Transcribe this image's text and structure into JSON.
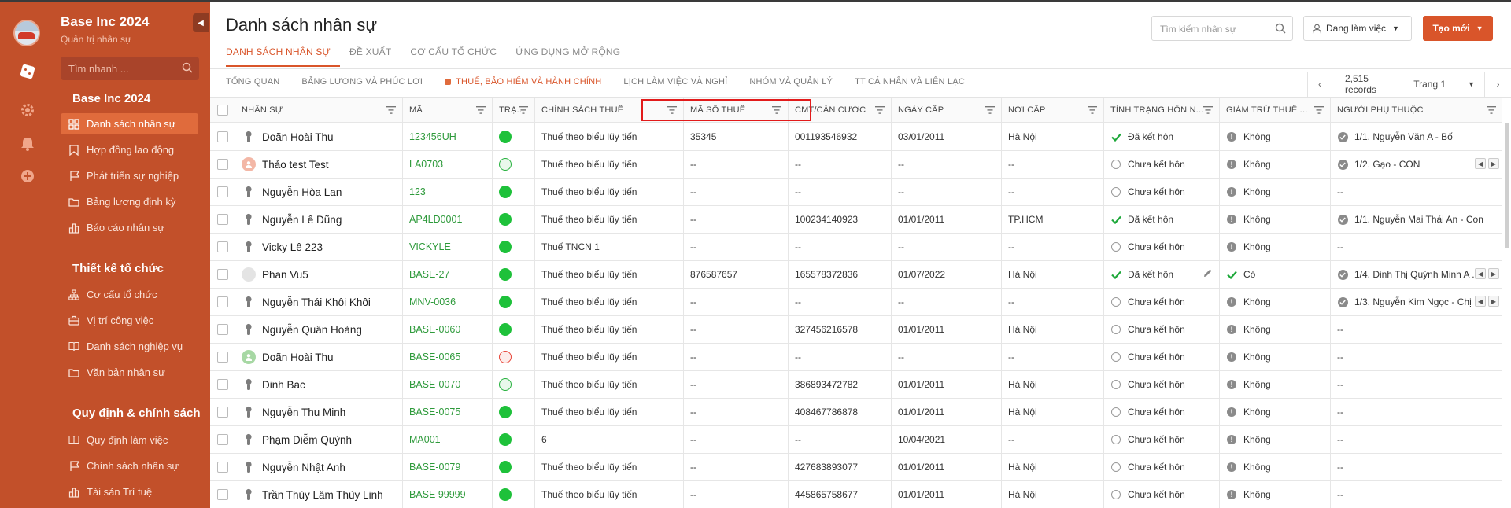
{
  "sidebar": {
    "company": "Base Inc 2024",
    "subtitle": "Quản trị nhân sự",
    "search_placeholder": "Tìm nhanh ...",
    "sections": [
      {
        "title": "Base Inc 2024",
        "items": [
          {
            "label": "Danh sách nhân sự",
            "icon": "grid-icon",
            "active": true
          },
          {
            "label": "Hợp đồng lao động",
            "icon": "bookmark-icon"
          },
          {
            "label": "Phát triển sự nghiệp",
            "icon": "flag-icon"
          },
          {
            "label": "Bảng lương định kỳ",
            "icon": "folder-icon"
          },
          {
            "label": "Báo cáo nhân sự",
            "icon": "bar-chart-icon"
          }
        ]
      },
      {
        "title": "Thiết kế tổ chức",
        "items": [
          {
            "label": "Cơ cấu tổ chức",
            "icon": "org-chart-icon"
          },
          {
            "label": "Vị trí công việc",
            "icon": "briefcase-icon"
          },
          {
            "label": "Danh sách nghiệp vụ",
            "icon": "book-icon"
          },
          {
            "label": "Văn bản nhân sự",
            "icon": "folder-icon"
          }
        ]
      },
      {
        "title": "Quy định & chính sách",
        "items": [
          {
            "label": "Quy định làm việc",
            "icon": "book-icon"
          },
          {
            "label": "Chính sách nhân sự",
            "icon": "flag-icon"
          },
          {
            "label": "Tài sản Trí tuệ",
            "icon": "bar-chart-icon"
          }
        ]
      }
    ]
  },
  "header": {
    "title": "Danh sách nhân sự",
    "tabs": [
      "DANH SÁCH NHÂN SỰ",
      "ĐỀ XUẤT",
      "CƠ CẤU TỔ CHỨC",
      "ỨNG DỤNG MỞ RỘNG"
    ],
    "search_placeholder": "Tìm kiếm nhân sự",
    "status_filter": "Đang làm việc",
    "create_label": "Tạo mới"
  },
  "subtabs": [
    "TỔNG QUAN",
    "BẢNG LƯƠNG VÀ PHÚC LỢI",
    "THUẾ, BẢO HIỂM VÀ HÀNH CHÍNH",
    "LỊCH LÀM VIỆC VÀ NGHỈ",
    "NHÓM VÀ QUẢN LÝ",
    "TT CÁ NHÂN VÀ LIÊN LẠC"
  ],
  "pager": {
    "records": "2,515 records",
    "page": "Trang 1"
  },
  "table": {
    "columns": [
      "NHÂN SỰ",
      "MÃ",
      "TRẠ...",
      "CHÍNH SÁCH THUẾ",
      "MÃ SỐ THUẾ",
      "CMT/CĂN CƯỚC",
      "NGÀY CẤP",
      "NƠI CẤP",
      "TÌNH TRẠNG HÔN N...",
      "GIẢM TRỪ THUẾ ...",
      "NGƯỜI PHỤ THUỘC"
    ],
    "rows": [
      {
        "name": "Doãn Hoài Thu",
        "avatar": "person",
        "code": "123456UH",
        "status": "active",
        "policy": "Thuế theo biểu lũy tiến",
        "tax": "35345",
        "id": "001193546932",
        "date": "03/01/2011",
        "place": "Hà Nội",
        "marital": "Đã kết hôn",
        "marital_mark": "check",
        "deduct": "Không",
        "deduct_mark": "info",
        "dep": "1/1. Nguyễn Văn A - Bố",
        "dep_mark": "check",
        "dep_nav": false
      },
      {
        "name": "Thảo test Test",
        "avatar": "pink",
        "code": "LA0703",
        "status": "outline-green",
        "policy": "Thuế theo biểu lũy tiến",
        "tax": "--",
        "id": "--",
        "date": "--",
        "place": "--",
        "marital": "Chưa kết hôn",
        "marital_mark": "empty",
        "deduct": "Không",
        "deduct_mark": "info",
        "dep": "1/2. Gạo - CON",
        "dep_mark": "check",
        "dep_nav": true
      },
      {
        "name": "Nguyễn Hòa Lan",
        "avatar": "person",
        "code": "123",
        "status": "active",
        "policy": "Thuế theo biểu lũy tiến",
        "tax": "--",
        "id": "--",
        "date": "--",
        "place": "--",
        "marital": "Chưa kết hôn",
        "marital_mark": "empty",
        "deduct": "Không",
        "deduct_mark": "info",
        "dep": "--",
        "dep_mark": "",
        "dep_nav": false
      },
      {
        "name": "Nguyễn Lê Dũng",
        "avatar": "person",
        "code": "AP4LD0001",
        "status": "active",
        "policy": "Thuế theo biểu lũy tiến",
        "tax": "--",
        "id": "100234140923",
        "date": "01/01/2011",
        "place": "TP.HCM",
        "marital": "Đã kết hôn",
        "marital_mark": "check",
        "deduct": "Không",
        "deduct_mark": "info",
        "dep": "1/1. Nguyễn Mai Thái An - Con",
        "dep_mark": "check",
        "dep_nav": false
      },
      {
        "name": "Vicky Lê 223",
        "avatar": "person",
        "code": "VICKYLE",
        "status": "active",
        "policy": "Thuế TNCN 1",
        "tax": "--",
        "id": "--",
        "date": "--",
        "place": "--",
        "marital": "Chưa kết hôn",
        "marital_mark": "empty",
        "deduct": "Không",
        "deduct_mark": "info",
        "dep": "--",
        "dep_mark": "",
        "dep_nav": false
      },
      {
        "name": "Phan Vu5",
        "avatar": "gray",
        "code": "BASE-27",
        "status": "active",
        "policy": "Thuế theo biểu lũy tiến",
        "tax": "876587657",
        "id": "165578372836",
        "date": "01/07/2022",
        "place": "Hà Nội",
        "marital": "Đã kết hôn",
        "marital_mark": "check",
        "marital_edit": true,
        "deduct": "Có",
        "deduct_mark": "check-green",
        "dep": "1/4. Đinh Thị Quỳnh Minh A ...",
        "dep_mark": "check",
        "dep_nav": true
      },
      {
        "name": "Nguyễn Thái Khôi Khôi",
        "avatar": "person",
        "code": "MNV-0036",
        "status": "active",
        "policy": "Thuế theo biểu lũy tiến",
        "tax": "--",
        "id": "--",
        "date": "--",
        "place": "--",
        "marital": "Chưa kết hôn",
        "marital_mark": "empty",
        "deduct": "Không",
        "deduct_mark": "info",
        "dep": "1/3. Nguyễn Kim Ngọc - Chị ...",
        "dep_mark": "check",
        "dep_nav": true
      },
      {
        "name": "Nguyễn Quân Hoàng",
        "avatar": "person",
        "code": "BASE-0060",
        "status": "active",
        "policy": "Thuế theo biểu lũy tiến",
        "tax": "--",
        "id": "327456216578",
        "date": "01/01/2011",
        "place": "Hà Nội",
        "marital": "Chưa kết hôn",
        "marital_mark": "empty",
        "deduct": "Không",
        "deduct_mark": "info",
        "dep": "--",
        "dep_mark": "",
        "dep_nav": false
      },
      {
        "name": "Doãn Hoài Thu",
        "avatar": "green",
        "code": "BASE-0065",
        "status": "outline-red",
        "policy": "Thuế theo biểu lũy tiến",
        "tax": "--",
        "id": "--",
        "date": "--",
        "place": "--",
        "marital": "Chưa kết hôn",
        "marital_mark": "empty",
        "deduct": "Không",
        "deduct_mark": "info",
        "dep": "--",
        "dep_mark": "",
        "dep_nav": false
      },
      {
        "name": "Dinh Bac",
        "avatar": "person",
        "code": "BASE-0070",
        "status": "outline-green",
        "policy": "Thuế theo biểu lũy tiến",
        "tax": "--",
        "id": "386893472782",
        "date": "01/01/2011",
        "place": "Hà Nội",
        "marital": "Chưa kết hôn",
        "marital_mark": "empty",
        "deduct": "Không",
        "deduct_mark": "info",
        "dep": "--",
        "dep_mark": "",
        "dep_nav": false
      },
      {
        "name": "Nguyễn Thu Minh",
        "avatar": "person",
        "code": "BASE-0075",
        "status": "active",
        "policy": "Thuế theo biểu lũy tiến",
        "tax": "--",
        "id": "408467786878",
        "date": "01/01/2011",
        "place": "Hà Nội",
        "marital": "Chưa kết hôn",
        "marital_mark": "empty",
        "deduct": "Không",
        "deduct_mark": "info",
        "dep": "--",
        "dep_mark": "",
        "dep_nav": false
      },
      {
        "name": "Phạm Diễm Quỳnh",
        "avatar": "person",
        "code": "MA001",
        "status": "active",
        "policy": "6",
        "tax": "--",
        "id": "--",
        "date": "10/04/2021",
        "place": "--",
        "marital": "Chưa kết hôn",
        "marital_mark": "empty",
        "deduct": "Không",
        "deduct_mark": "info",
        "dep": "--",
        "dep_mark": "",
        "dep_nav": false
      },
      {
        "name": "Nguyễn Nhật Anh",
        "avatar": "person",
        "code": "BASE-0079",
        "status": "active",
        "policy": "Thuế theo biểu lũy tiến",
        "tax": "--",
        "id": "427683893077",
        "date": "01/01/2011",
        "place": "Hà Nội",
        "marital": "Chưa kết hôn",
        "marital_mark": "empty",
        "deduct": "Không",
        "deduct_mark": "info",
        "dep": "--",
        "dep_mark": "",
        "dep_nav": false
      },
      {
        "name": "Trần Thùy Lâm Thùy Linh",
        "avatar": "person",
        "code": "BASE 99999",
        "status": "active",
        "policy": "Thuế theo biểu lũy tiến",
        "tax": "--",
        "id": "445865758677",
        "date": "01/01/2011",
        "place": "Hà Nội",
        "marital": "Chưa kết hôn",
        "marital_mark": "empty",
        "deduct": "Không",
        "deduct_mark": "info",
        "dep": "--",
        "dep_mark": "",
        "dep_nav": false
      }
    ]
  },
  "colors": {
    "brand": "#c2502a",
    "accent": "#d9552a",
    "active_item": "#e06b3c",
    "status_green": "#1ec13a",
    "highlight_box": "#e21b1b"
  }
}
